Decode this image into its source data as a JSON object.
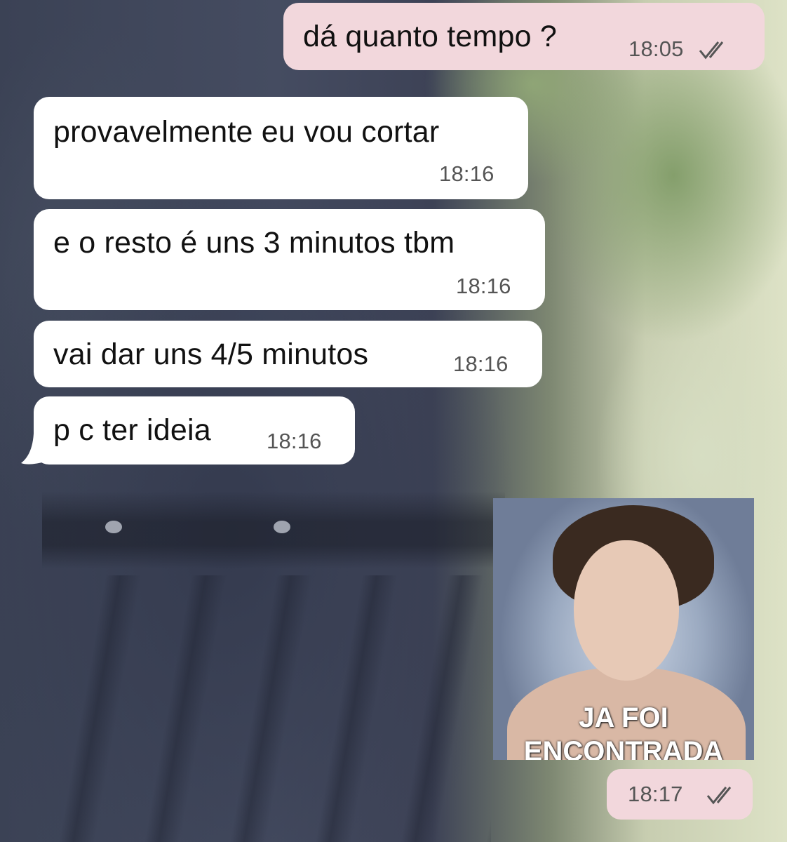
{
  "chat": {
    "messages": [
      {
        "direction": "outgoing",
        "text": "dá quanto tempo ?",
        "time": "18:05",
        "status": "read"
      },
      {
        "direction": "incoming",
        "text": "provavelmente eu vou cortar",
        "time": "18:16"
      },
      {
        "direction": "incoming",
        "text": "e o resto é uns 3 minutos tbm",
        "time": "18:16"
      },
      {
        "direction": "incoming",
        "text": "vai dar uns 4/5 minutos",
        "time": "18:16"
      },
      {
        "direction": "incoming",
        "text": "p c ter ideia",
        "time": "18:16"
      }
    ],
    "sticker": {
      "caption_line1": "JA FOI",
      "caption_line2": "ENCONTRADA",
      "time": "18:17",
      "status": "read"
    }
  },
  "colors": {
    "outgoing_bubble": "#f2d7dc",
    "incoming_bubble": "#ffffff",
    "text": "#111111",
    "timestamp": "#555555"
  },
  "icons": {
    "read_receipt": "double-check-icon"
  }
}
